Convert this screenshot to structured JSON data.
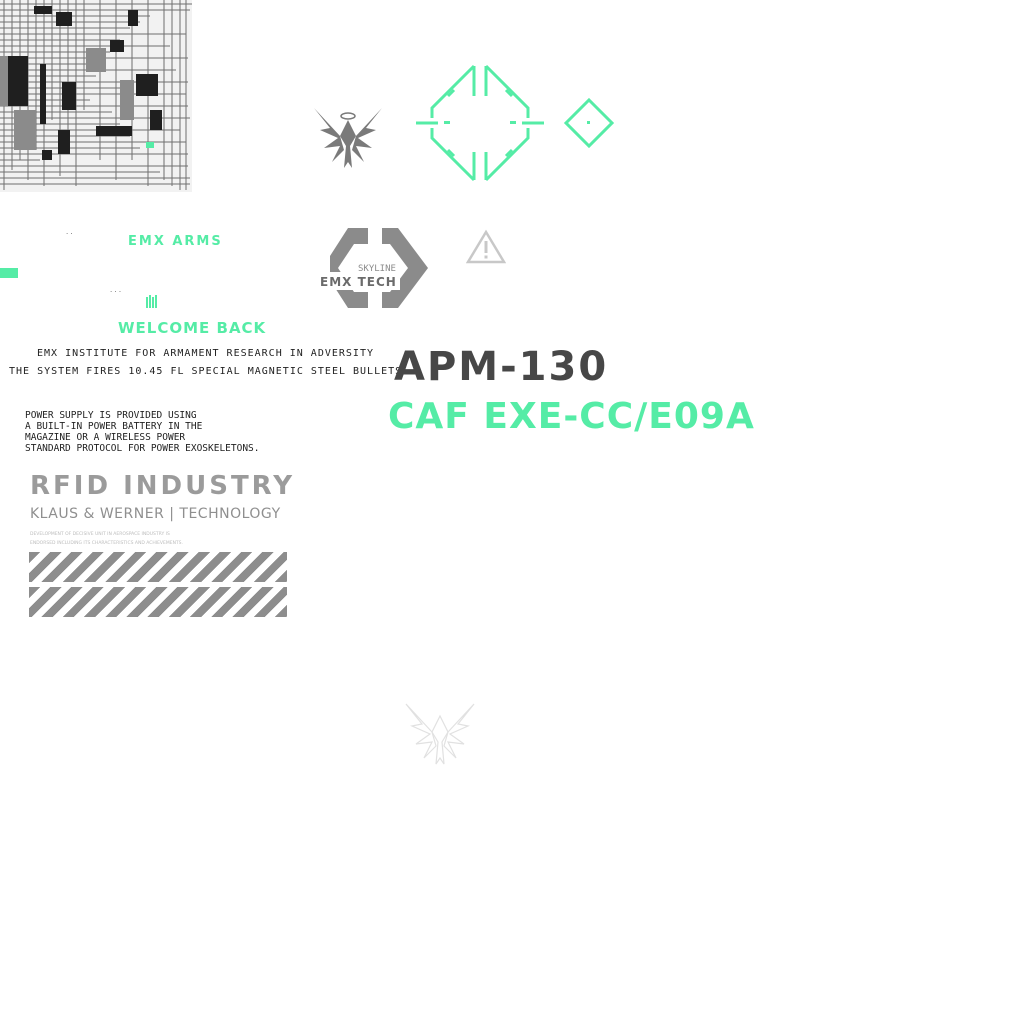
{
  "colors": {
    "accent": "#55eca6",
    "dark": "#474747",
    "gray": "#9b9b9b",
    "text": "#222222"
  },
  "brand": {
    "arms": "EMX ARMS",
    "welcome": "WELCOME BACK"
  },
  "info": {
    "institute": "EMX INSTITUTE FOR ARMAMENT RESEARCH IN ADVERSITY",
    "fires": "THE SYSTEM FIRES 10.45 FL SPECIAL MAGNETIC STEEL BULLETS",
    "power_lines": [
      "POWER SUPPLY IS PROVIDED USING",
      "A BUILT-IN POWER BATTERY IN THE",
      "MAGAZINE OR A WIRELESS POWER",
      "STANDARD PROTOCOL FOR POWER EXOSKELETONS."
    ]
  },
  "industry": {
    "title": "RFID INDUSTRY",
    "subtitle": "KLAUS & WERNER | TECHNOLOGY",
    "fine_lines": [
      "DEVELOPMENT OF DECISIVE UNIT IN AEROSPACE INDUSTRY IS",
      "ENDORSED INCLUDING ITS CHARACTERISTICS AND ACHIEVEMENTS."
    ]
  },
  "logo": {
    "top": "SKYLINE",
    "main": "EMX TECH"
  },
  "model": {
    "name": "APM-130",
    "code": "CAF EXE-CC/E09A"
  },
  "icons": [
    "circuit-texture-icon",
    "winged-emblem-icon",
    "crosshair-reticle-icon",
    "diamond-target-icon",
    "emx-tech-logo-icon",
    "warning-triangle-icon",
    "ammo-icon"
  ]
}
